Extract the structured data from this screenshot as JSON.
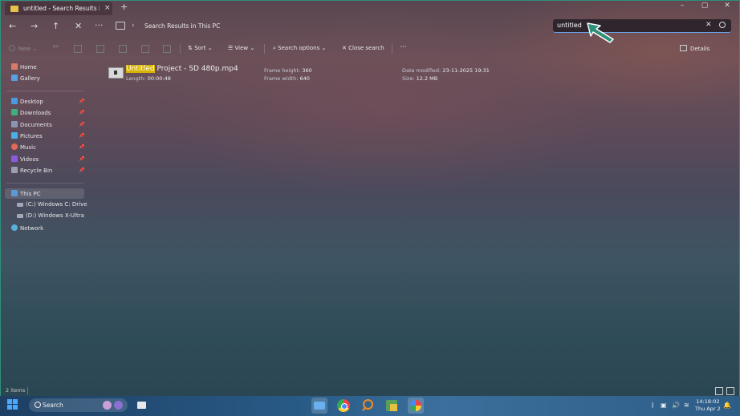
{
  "window": {
    "tab_title": "untitled - Search Results in Th",
    "tab_close": "×",
    "new_tab": "+",
    "minimize": "–",
    "maximize": "▢",
    "close": "✕"
  },
  "address": {
    "back": "←",
    "forward": "→",
    "up": "↑",
    "cancel": "✕",
    "more": "···",
    "chevron": "›",
    "breadcrumb": "Search Results in This PC",
    "search_value": "untitled",
    "search_clear": "✕"
  },
  "commands": {
    "new": "New",
    "sort": "Sort",
    "view": "View",
    "search_options": "Search options",
    "close_search": "Close search",
    "more": "···",
    "details": "Details"
  },
  "nav": {
    "home": "Home",
    "gallery": "Gallery",
    "quick": [
      {
        "label": "Desktop",
        "color": "#4a9ae0"
      },
      {
        "label": "Downloads",
        "color": "#3fb07a"
      },
      {
        "label": "Documents",
        "color": "#8a96b0"
      },
      {
        "label": "Pictures",
        "color": "#4ab0e8"
      },
      {
        "label": "Music",
        "color": "#e06a5a"
      },
      {
        "label": "Videos",
        "color": "#8a5ae0"
      },
      {
        "label": "Recycle Bin",
        "color": "#9aa0b0"
      }
    ],
    "this_pc": "This PC",
    "drives": [
      "(C:) Windows C: Drive",
      "(D:) Windows X-Ultra"
    ],
    "network": "Network"
  },
  "result": {
    "name_highlight": "Untitled",
    "name_rest": " Project - SD 480p.mp4",
    "length_label": "Length:",
    "length_value": "00:00:48",
    "frame_height_label": "Frame height:",
    "frame_height_value": "360",
    "frame_width_label": "Frame width:",
    "frame_width_value": "640",
    "date_label": "Date modified:",
    "date_value": "23-11-2025 19:31",
    "size_label": "Size:",
    "size_value": "12.2 MB"
  },
  "status": {
    "items": "2 items"
  },
  "taskbar": {
    "search": "Search",
    "time": "14:18:02",
    "date": "Thu Apr 2"
  },
  "colors": {
    "highlight": "#d6b300",
    "accent": "#6aa0e8",
    "pointer": "#2e8f7a"
  }
}
